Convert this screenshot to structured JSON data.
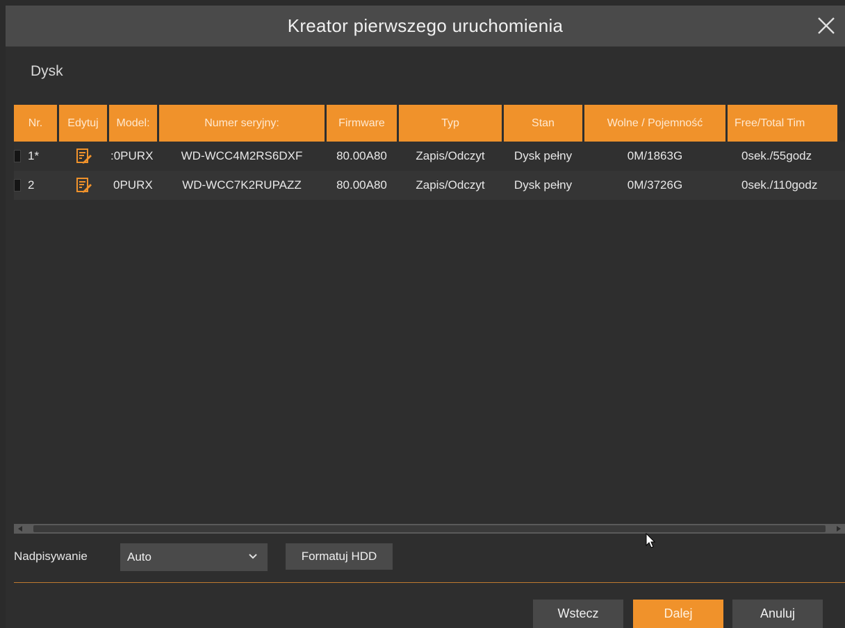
{
  "window": {
    "title": "Kreator pierwszego uruchomienia"
  },
  "section": {
    "label": "Dysk"
  },
  "table": {
    "columns": [
      "Nr.",
      "Edytuj",
      "Model:",
      "Numer seryjny:",
      "Firmware",
      "Typ",
      "Stan",
      "Wolne / Pojemność",
      "Free/Total Tim"
    ],
    "rows": [
      {
        "nr": "1*",
        "model": ":0PURX",
        "serial": "WD-WCC4M2RS6DXF",
        "firmware": "80.00A80",
        "type": "Zapis/Odczyt",
        "state": "Dysk pełny",
        "capacity": "0M/1863G",
        "time": "0sek./55godz"
      },
      {
        "nr": "2",
        "model": "0PURX",
        "serial": "WD-WCC7K2RUPAZZ",
        "firmware": "80.00A80",
        "type": "Zapis/Odczyt",
        "state": "Dysk pełny",
        "capacity": "0M/3726G",
        "time": "0sek./110godz"
      }
    ]
  },
  "overwrite": {
    "label": "Nadpisywanie",
    "value": "Auto"
  },
  "format_button": "Formatuj HDD",
  "footer": {
    "back": "Wstecz",
    "next": "Dalej",
    "cancel": "Anuluj"
  },
  "colors": {
    "accent": "#f0922b",
    "background": "#2e2e2e",
    "titlebar": "#4a4a4a"
  }
}
